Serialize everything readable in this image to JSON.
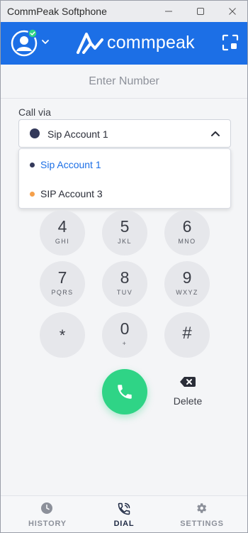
{
  "window": {
    "title": "CommPeak Softphone"
  },
  "header": {
    "logo_text": "commpeak",
    "status_color": "#2fd486"
  },
  "dialer": {
    "number_placeholder": "Enter Number",
    "call_via_label": "Call via",
    "selected_account": "Sip Account 1",
    "accounts": [
      {
        "label": "Sip Account 1",
        "dot_color": "#33395a",
        "text_color": "#1c6fe6"
      },
      {
        "label": "SIP Account 3",
        "dot_color": "#f5a04a",
        "text_color": "#2a2d38"
      }
    ]
  },
  "keypad": [
    {
      "digit": "4",
      "letters": "GHI"
    },
    {
      "digit": "5",
      "letters": "JKL"
    },
    {
      "digit": "6",
      "letters": "MNO"
    },
    {
      "digit": "7",
      "letters": "PQRS"
    },
    {
      "digit": "8",
      "letters": "TUV"
    },
    {
      "digit": "9",
      "letters": "WXYZ"
    },
    {
      "digit": "*",
      "letters": ""
    },
    {
      "digit": "0",
      "letters": "+"
    },
    {
      "digit": "#",
      "letters": ""
    }
  ],
  "actions": {
    "delete_label": "Delete"
  },
  "nav": {
    "items": [
      {
        "label": "HISTORY",
        "icon": "clock-icon",
        "active": false
      },
      {
        "label": "DIAL",
        "icon": "phone-dial-icon",
        "active": true
      },
      {
        "label": "SETTINGS",
        "icon": "gear-icon",
        "active": false
      }
    ],
    "active_color": "#1f2a44",
    "inactive_color": "#8c909a"
  },
  "colors": {
    "brand": "#1c6fe6",
    "call": "#2fd486"
  }
}
